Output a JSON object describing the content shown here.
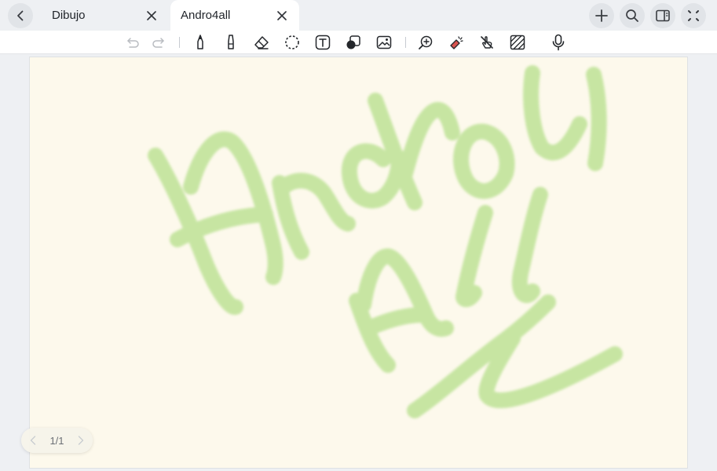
{
  "tabs": [
    {
      "label": "Dibujo",
      "active": false
    },
    {
      "label": "Andro4all",
      "active": true
    }
  ],
  "tabbar_actions": [
    "add-tab-icon",
    "search-icon",
    "sidebar-layout-icon",
    "more-apps-icon"
  ],
  "toolbar": {
    "tools": [
      "undo-icon",
      "redo-icon",
      "pen-icon",
      "highlighter-icon",
      "eraser-icon",
      "lasso-icon",
      "text-box-icon",
      "shapes-icon",
      "image-icon",
      "zoom-icon",
      "laser-pointer-icon",
      "finger-draw-icon",
      "background-pattern-icon",
      "microphone-icon"
    ]
  },
  "canvas": {
    "background": "#fdf9ec",
    "ink_color": "#b8e08e",
    "handwriting": "Andro4all"
  },
  "pager": {
    "label": "1/1"
  }
}
